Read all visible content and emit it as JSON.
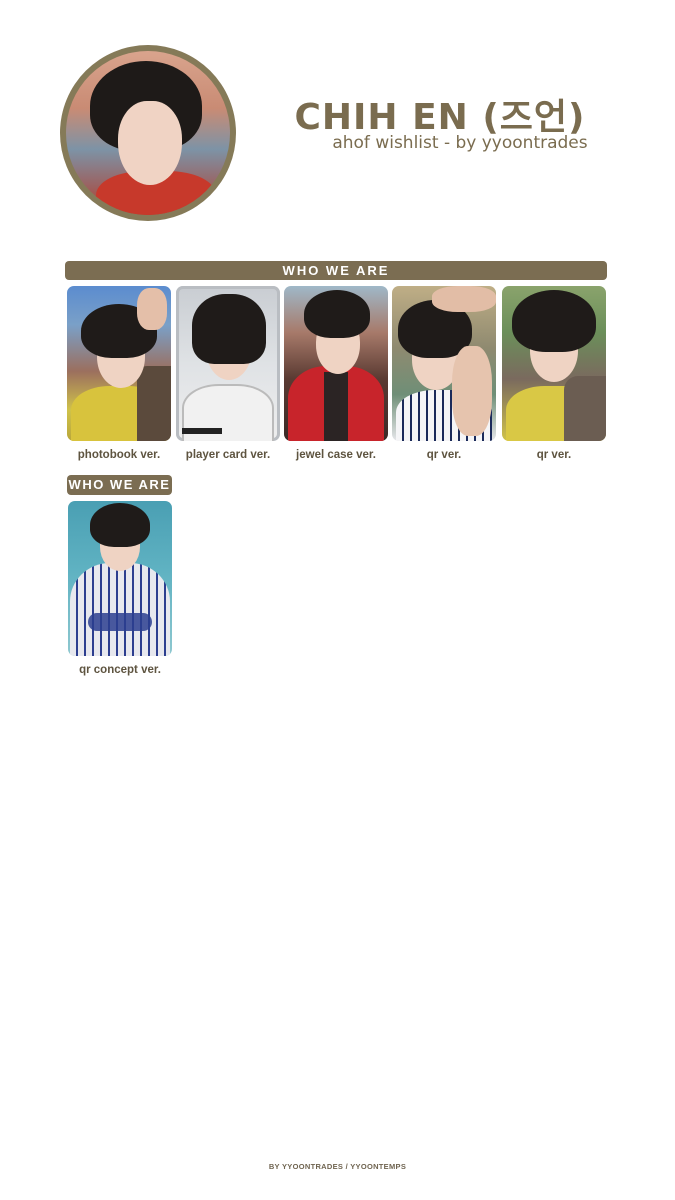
{
  "header": {
    "title": "CHIH EN (즈언)",
    "subtitle": "ahof wishlist - by yyoontrades"
  },
  "sections": [
    {
      "label": "WHO WE ARE",
      "cards": [
        {
          "label": "photobook ver."
        },
        {
          "label": "player card ver."
        },
        {
          "label": "jewel case ver."
        },
        {
          "label": "qr ver."
        },
        {
          "label": "qr ver."
        }
      ]
    },
    {
      "label": "WHO WE ARE",
      "cards": [
        {
          "label": "qr concept ver."
        }
      ]
    }
  ],
  "footer": "BY YYOONTRADES / YYOONTEMPS",
  "colors": {
    "accent": "#7b6d52",
    "text": "#7a6c4f",
    "background": "#ffffff"
  }
}
